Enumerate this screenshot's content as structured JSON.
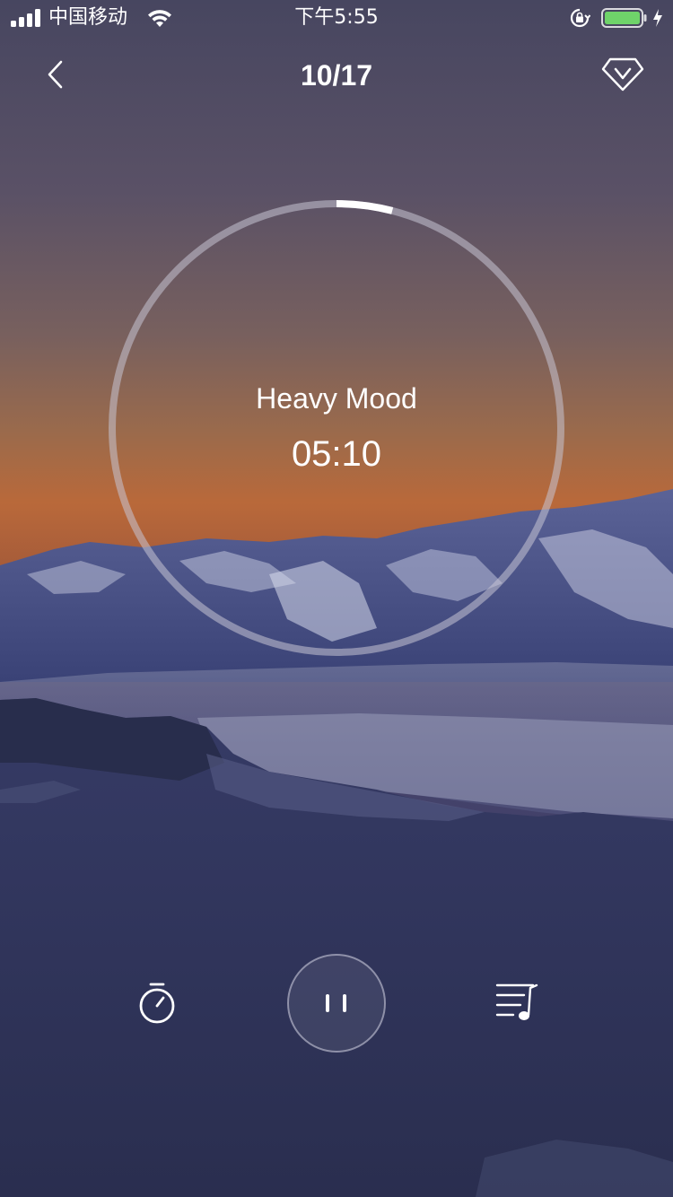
{
  "status_bar": {
    "carrier": "中国移动",
    "time": "下午5:55",
    "battery_color": "#6fd36a"
  },
  "nav": {
    "back_icon": "chevron-left-icon",
    "title": "10/17",
    "vip_icon": "diamond-v-icon"
  },
  "player": {
    "track_name": "Heavy Mood",
    "remaining_time": "05:10",
    "progress_fraction": 0.04,
    "controls": {
      "timer_icon": "stopwatch-icon",
      "pause_icon": "pause-icon",
      "playlist_icon": "playlist-music-icon"
    }
  },
  "colors": {
    "text": "#ffffff",
    "ring_track": "#c7c5d4",
    "ring_progress": "#ffffff",
    "sky_top": "#474660",
    "sky_horizon": "#c3693a",
    "mountain": "#3d4678"
  }
}
